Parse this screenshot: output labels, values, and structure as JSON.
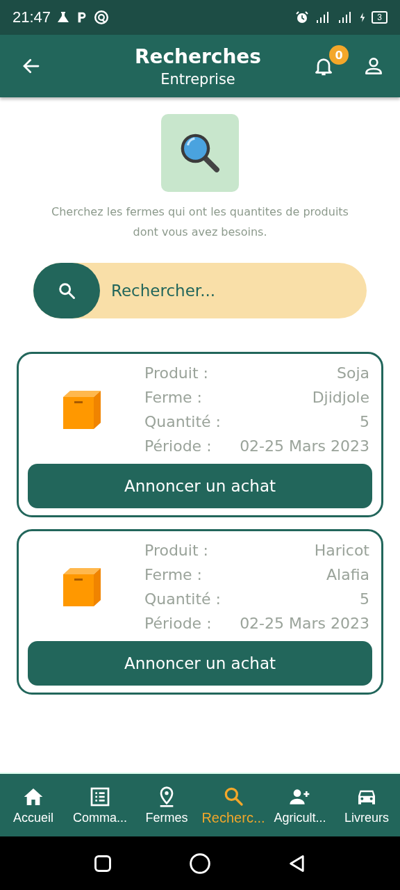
{
  "status_bar": {
    "time": "21:47",
    "battery": "3"
  },
  "header": {
    "title": "Recherches",
    "subtitle": "Entreprise",
    "notifications": "0"
  },
  "intro": "Cherchez les fermes qui ont les quantites de produits dont vous avez besoins.",
  "search": {
    "placeholder": "Rechercher..."
  },
  "results": [
    {
      "fields": [
        {
          "label": "Produit :",
          "value": "Soja"
        },
        {
          "label": "Ferme :",
          "value": "Djidjole"
        },
        {
          "label": "Quantité :",
          "value": "5"
        },
        {
          "label": "Période :",
          "value": "02-25 Mars 2023"
        }
      ],
      "button": "Annoncer un achat"
    },
    {
      "fields": [
        {
          "label": "Produit :",
          "value": "Haricot"
        },
        {
          "label": "Ferme :",
          "value": "Alafia"
        },
        {
          "label": "Quantité :",
          "value": "5"
        },
        {
          "label": "Période :",
          "value": "02-25 Mars 2023"
        }
      ],
      "button": "Annoncer un achat"
    }
  ],
  "bottom_nav": [
    {
      "kind": "home",
      "label": "Accueil",
      "selected": false
    },
    {
      "kind": "list",
      "label": "Comma...",
      "selected": false
    },
    {
      "kind": "pin",
      "label": "Fermes",
      "selected": false
    },
    {
      "kind": "search",
      "label": "Recherc...",
      "selected": true
    },
    {
      "kind": "adduser",
      "label": "Agricult...",
      "selected": false
    },
    {
      "kind": "car",
      "label": "Livreurs",
      "selected": false
    }
  ]
}
